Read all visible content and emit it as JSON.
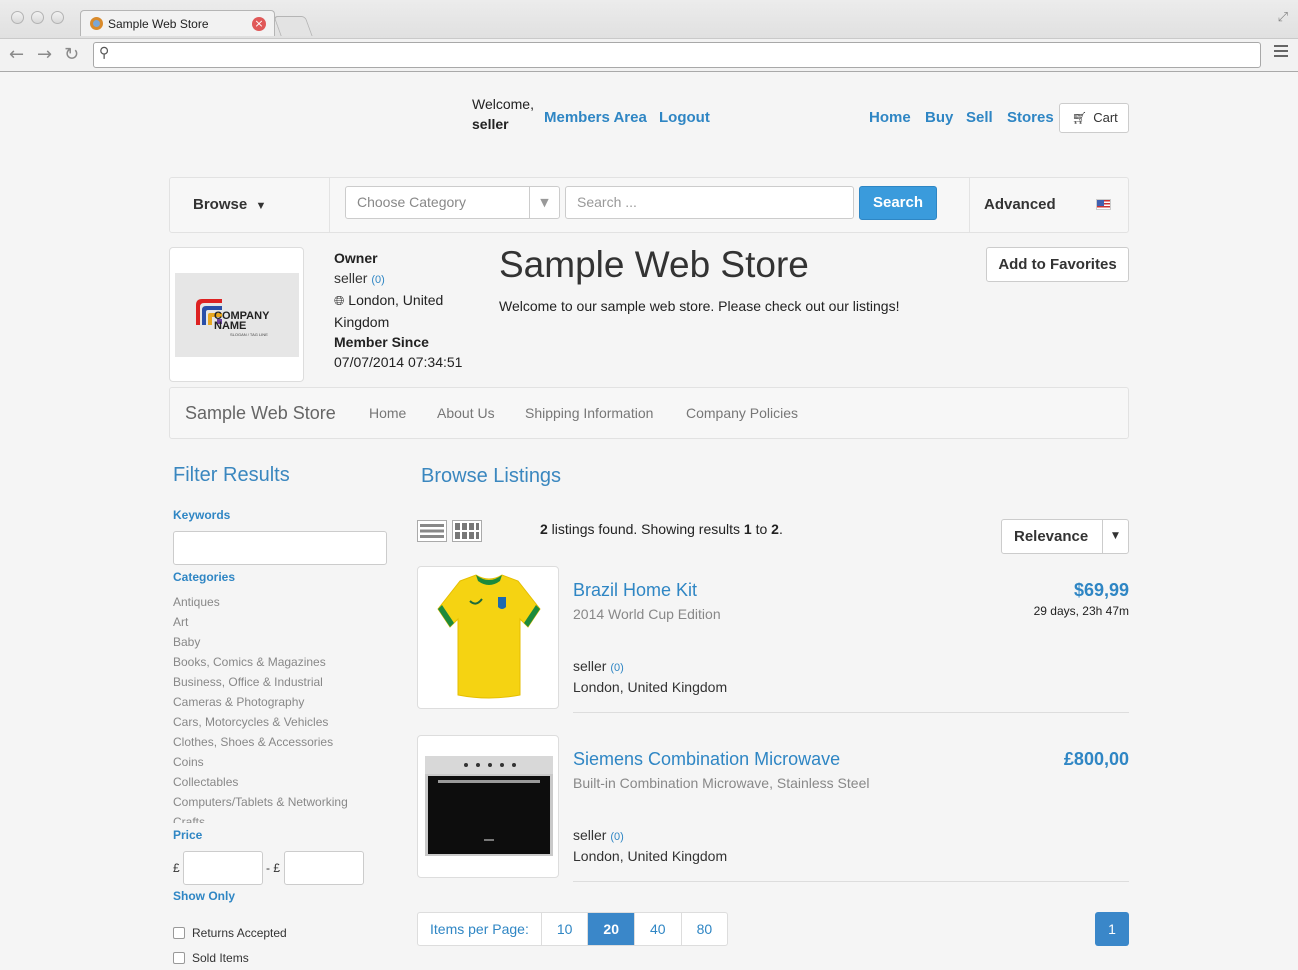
{
  "browser": {
    "tab_title": "Sample Web Store",
    "close": "×",
    "address": ""
  },
  "topnav": {
    "welcome": "Welcome,",
    "username": "seller",
    "members_area": "Members Area",
    "logout": "Logout",
    "home": "Home",
    "buy": "Buy",
    "sell": "Sell",
    "stores": "Stores",
    "cart": "Cart"
  },
  "searchbar": {
    "browse": "Browse",
    "browse_arrow": "▼",
    "category_placeholder": "Choose Category",
    "search_placeholder": "Search ...",
    "search_button": "Search",
    "advanced": "Advanced"
  },
  "store": {
    "logo_text": "COMPANY NAME",
    "logo_slogan": "SLOGAN / TAG LINE",
    "owner_label": "Owner",
    "owner_name": "seller",
    "owner_count": "(0)",
    "location_line1": "London, United",
    "location_line2": "Kingdom",
    "member_since_label": "Member Since",
    "member_since": "07/07/2014 07:34:51",
    "title": "Sample Web Store",
    "description": "Welcome to our sample web store. Please check out our listings!",
    "add_favorites": "Add to Favorites"
  },
  "storenav": {
    "brand": "Sample Web Store",
    "links": [
      "Home",
      "About Us",
      "Shipping Information",
      "Company Policies"
    ]
  },
  "filters": {
    "title": "Filter Results",
    "keywords_label": "Keywords",
    "categories_label": "Categories",
    "categories": [
      "Antiques",
      "Art",
      "Baby",
      "Books, Comics & Magazines",
      "Business, Office & Industrial",
      "Cameras & Photography",
      "Cars, Motorcycles & Vehicles",
      "Clothes, Shoes & Accessories",
      "Coins",
      "Collectables",
      "Computers/Tablets & Networking",
      "Crafts"
    ],
    "price_label": "Price",
    "currency": "£",
    "price_sep": "- £",
    "show_only_label": "Show Only",
    "returns_accepted": "Returns Accepted",
    "sold_items": "Sold Items"
  },
  "listings": {
    "title": "Browse Listings",
    "found_count": "2",
    "found_text": " listings found. Showing results ",
    "from": "1",
    "to_text": " to ",
    "to": "2",
    "period": ".",
    "sort": "Relevance",
    "items": [
      {
        "title": "Brazil Home Kit",
        "subtitle": "2014 World Cup Edition",
        "seller": "seller",
        "seller_count": "(0)",
        "location": "London, United Kingdom",
        "price": "$69,99",
        "time_left": "29 days, 23h 47m"
      },
      {
        "title": "Siemens Combination Microwave",
        "subtitle": "Built-in Combination Microwave, Stainless Steel",
        "seller": "seller",
        "seller_count": "(0)",
        "location": "London, United Kingdom",
        "price": "£800,00",
        "time_left": ""
      }
    ]
  },
  "pagination": {
    "items_per_page_label": "Items per Page:",
    "options": [
      "10",
      "20",
      "40",
      "80"
    ],
    "selected": "20",
    "current_page": "1"
  }
}
